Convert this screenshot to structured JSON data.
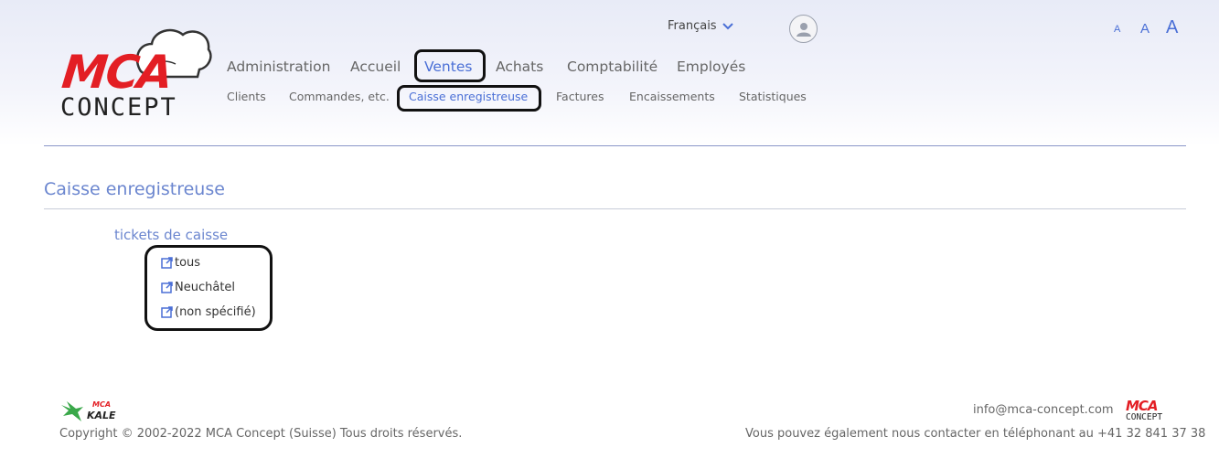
{
  "logo": {
    "text_top": "MCA",
    "text_bottom": "CONCEPT"
  },
  "header": {
    "language": "Français",
    "font_sizes": [
      "A",
      "A",
      "A"
    ]
  },
  "main_nav": [
    {
      "label": "Administration"
    },
    {
      "label": "Accueil"
    },
    {
      "label": "Ventes",
      "active": true
    },
    {
      "label": "Achats"
    },
    {
      "label": "Comptabilité"
    },
    {
      "label": "Employés"
    }
  ],
  "sub_nav": [
    {
      "label": "Clients"
    },
    {
      "label": "Commandes, etc."
    },
    {
      "label": "Caisse enregistreuse",
      "active": true
    },
    {
      "label": "Factures"
    },
    {
      "label": "Encaissements"
    },
    {
      "label": "Statistiques"
    }
  ],
  "page": {
    "title": "Caisse enregistreuse",
    "section": "tickets de caisse",
    "links": [
      {
        "label": "tous",
        "icon": "external-link-icon"
      },
      {
        "label": "Neuchâtel",
        "icon": "external-link-icon"
      },
      {
        "label": "(non spécifié)",
        "icon": "external-link-icon"
      }
    ]
  },
  "footer": {
    "kale_logo": {
      "top": "MCA",
      "bottom": "KALE"
    },
    "copyright": "Copyright © 2002-2022 MCA Concept (Suisse) Tous droits réservés.",
    "email": "info@mca-concept.com",
    "logo": {
      "top": "MCA",
      "bottom": "CONCEPT"
    },
    "contact": "Vous pouvez également nous contacter en téléphonant au +41 32 841 37 38"
  },
  "colors": {
    "accent": "#4a6fd6",
    "brand_red": "#e31e24",
    "title": "#6b86cf"
  }
}
